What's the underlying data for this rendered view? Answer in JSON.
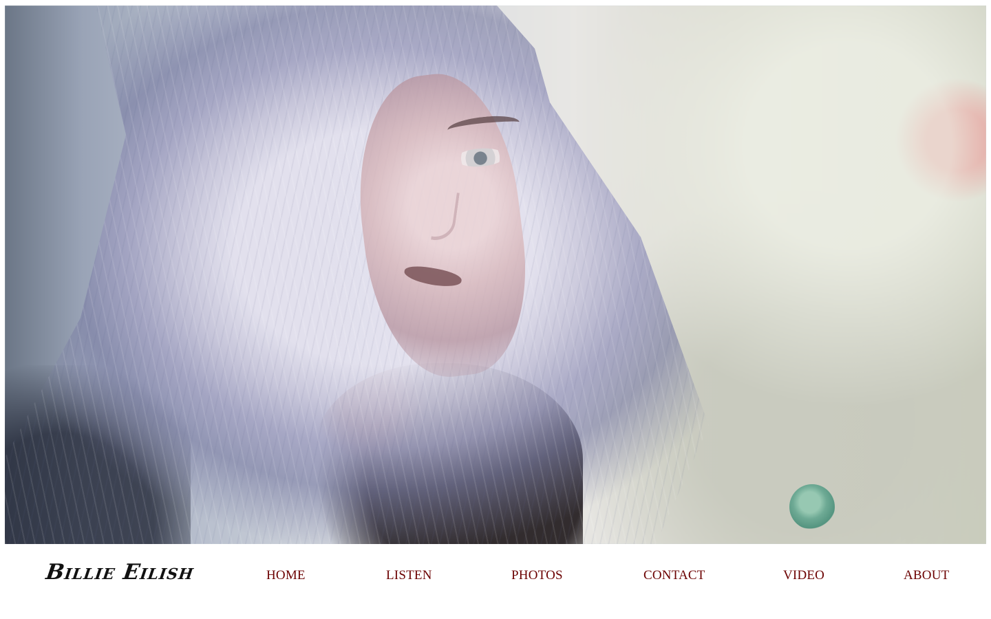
{
  "header": {
    "brand": "Billie Eilish"
  },
  "navigation": {
    "items": [
      {
        "label": "HOME"
      },
      {
        "label": "LISTEN"
      },
      {
        "label": "PHOTOS"
      },
      {
        "label": "CONTACT"
      },
      {
        "label": "VIDEO"
      },
      {
        "label": "ABOUT"
      }
    ]
  },
  "hero": {
    "image_alt": "Billie Eilish portrait"
  },
  "colors": {
    "nav_text": "#6b0000",
    "brand_text": "#111111",
    "page_background": "#ffffff"
  }
}
